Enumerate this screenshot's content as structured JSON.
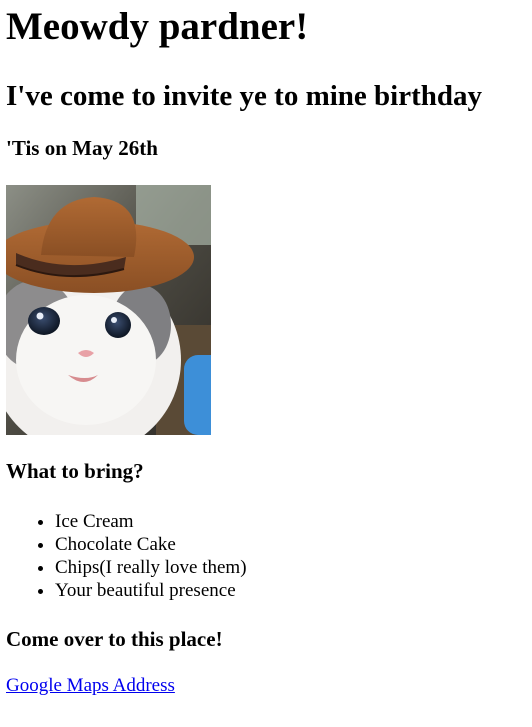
{
  "heading": "Meowdy pardner!",
  "invite": "I've come to invite ye to mine birthday",
  "date": "'Tis on May 26th",
  "photo": {
    "description": "cat-in-cowboy-hat"
  },
  "bring": {
    "title": "What to bring?",
    "items": [
      "Ice Cream",
      "Chocolate Cake",
      "Chips(I really love them)",
      "Your beautiful presence"
    ]
  },
  "place": {
    "title": "Come over to this place!",
    "link_text": "Google Maps Address"
  },
  "colors": {
    "link": "#0000ee",
    "text": "#000000",
    "background": "#ffffff"
  }
}
